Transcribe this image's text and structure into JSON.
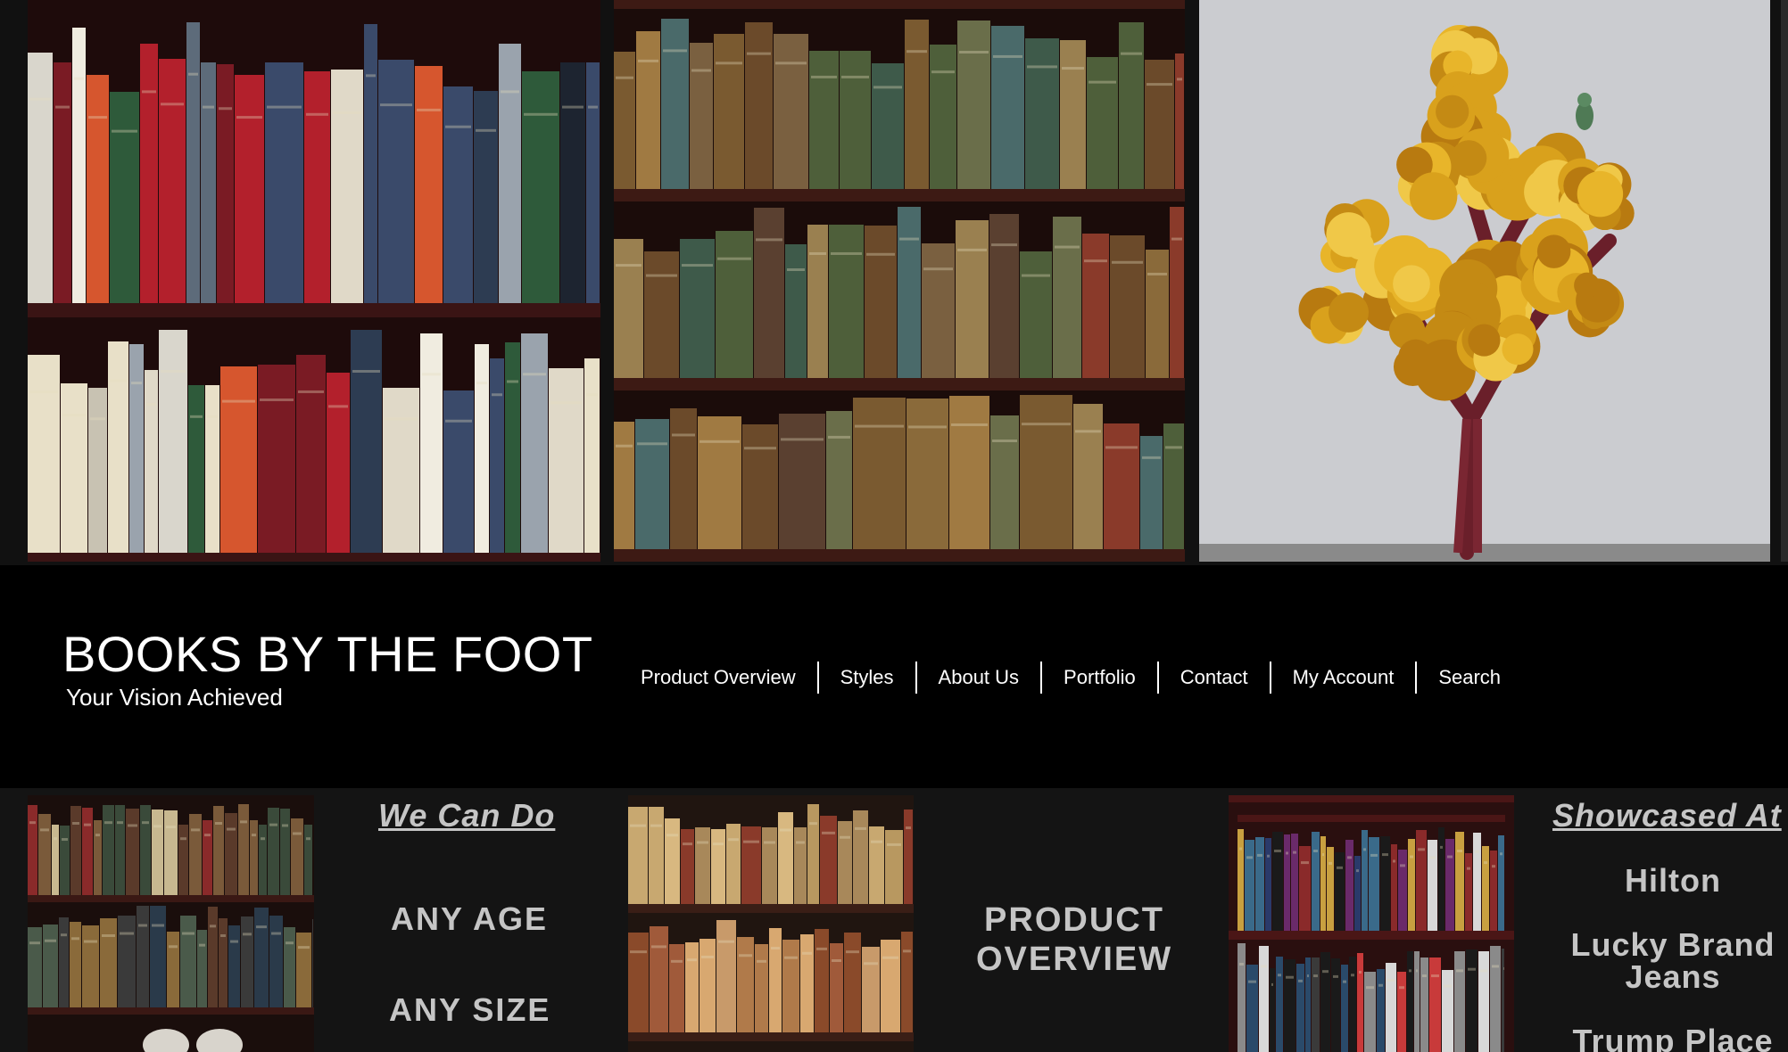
{
  "brand": {
    "title": "BOOKS BY THE FOOT",
    "tagline": "Your Vision Achieved"
  },
  "nav": {
    "items": [
      {
        "label": "Product Overview"
      },
      {
        "label": "Styles"
      },
      {
        "label": "About Us"
      },
      {
        "label": "Portfolio"
      },
      {
        "label": "Contact"
      },
      {
        "label": "My Account"
      },
      {
        "label": "Search"
      }
    ]
  },
  "hero": {
    "images": [
      {
        "name": "modern-art-books-shelf"
      },
      {
        "name": "antique-books-shelf"
      },
      {
        "name": "book-page-tree-sculpture"
      }
    ]
  },
  "sections": {
    "we_can_do": {
      "heading": "We Can Do",
      "items": [
        "ANY AGE",
        "ANY SIZE"
      ]
    },
    "product_overview": {
      "label_line1": "PRODUCT",
      "label_line2": "OVERVIEW"
    },
    "showcased_at": {
      "heading": "Showcased At",
      "clients": [
        "Hilton",
        "Lucky Brand Jeans",
        "Trump Place"
      ]
    }
  },
  "colors": {
    "background": "#000000",
    "lower_band": "#141414",
    "text_primary": "#ffffff",
    "text_muted": "#c5c5c5",
    "shelf_wood": "#3a1414",
    "tree_foliage": "#d9a11c"
  }
}
